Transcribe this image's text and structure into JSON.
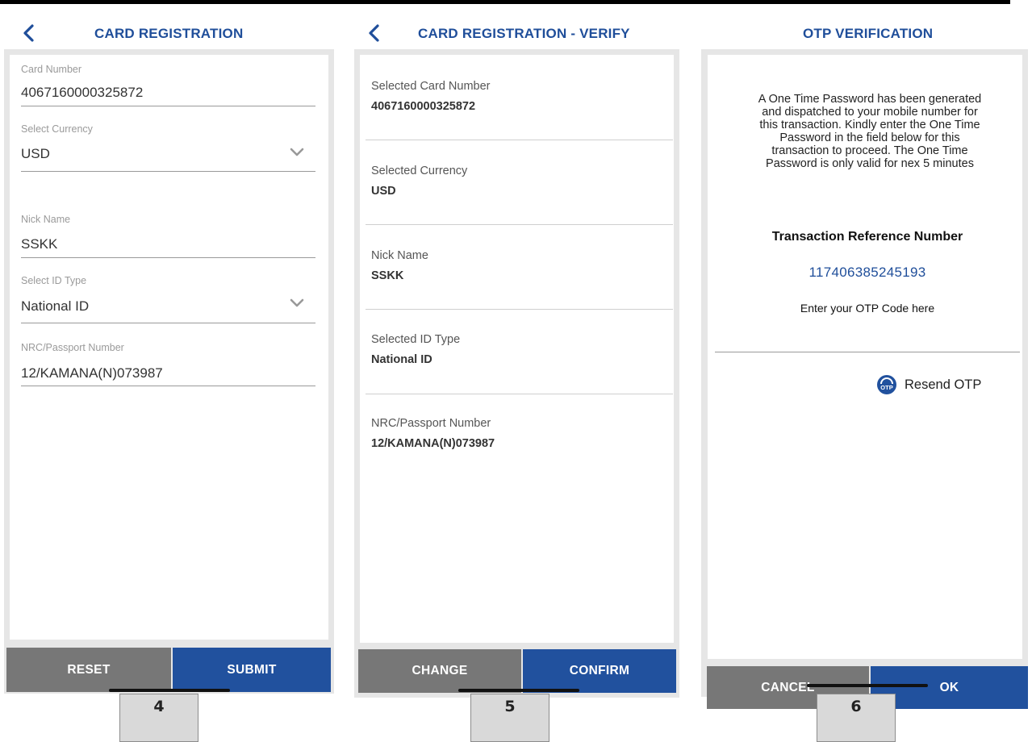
{
  "panel1": {
    "title": "CARD REGISTRATION",
    "fields": [
      {
        "label": "Card Number",
        "value": "4067160000325872"
      },
      {
        "label": "Select Currency",
        "value": "USD"
      },
      {
        "label": "Nick Name",
        "value": "SSKK"
      },
      {
        "label": "Select ID Type",
        "value": "National ID"
      },
      {
        "label": "NRC/Passport Number",
        "value": "12/KAMANA(N)073987"
      }
    ],
    "reset_label": "RESET",
    "submit_label": "SUBMIT",
    "step": "4"
  },
  "panel2": {
    "title": "CARD REGISTRATION - VERIFY",
    "rows": [
      {
        "label": "Selected Card Number",
        "value": "4067160000325872"
      },
      {
        "label": "Selected Currency",
        "value": "USD"
      },
      {
        "label": "Nick Name",
        "value": "SSKK"
      },
      {
        "label": "Selected ID Type",
        "value": "National ID"
      },
      {
        "label": "NRC/Passport Number",
        "value": "12/KAMANA(N)073987"
      }
    ],
    "change_label": "CHANGE",
    "confirm_label": "CONFIRM",
    "step": "5"
  },
  "panel3": {
    "title": "OTP VERIFICATION",
    "message_lines": [
      "A One Time Password has been generated",
      "and dispatched to your mobile number for",
      "this transaction. Kindly enter the One Time",
      "Password in the field below for this",
      "transaction to proceed. The One Time",
      "Password  is only valid for nex 5 minutes"
    ],
    "trn_label": "Transaction Reference Number",
    "trn_value": "117406385245193",
    "otp_prompt": "Enter your OTP Code here",
    "resend_icon_text": "OTP",
    "resend_label": "Resend OTP",
    "cancel_label": "CANCEL",
    "ok_label": "OK",
    "step": "6"
  },
  "colors": {
    "accent": "#1f4e9a",
    "button_blue": "#21519e",
    "button_grey": "#777777",
    "panel_bg": "#e6e6e6"
  },
  "icons": {
    "back": "back-arrow-icon",
    "dropdown": "chevron-down-icon",
    "resend": "otp-icon"
  }
}
